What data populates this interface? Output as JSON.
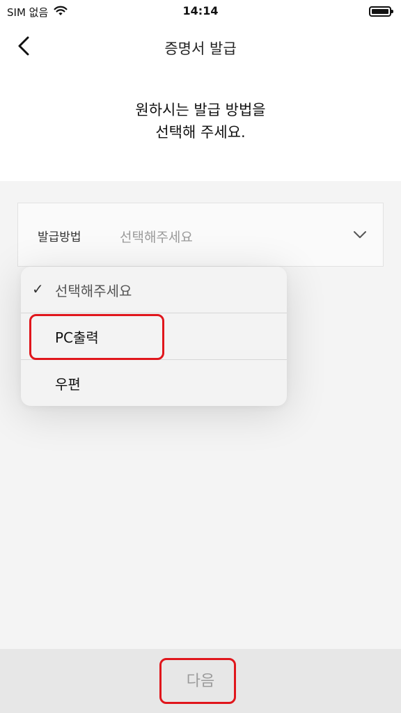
{
  "status_bar": {
    "carrier": "SIM 없음",
    "time": "14:14"
  },
  "header": {
    "title": "증명서 발급"
  },
  "instruction": {
    "line1": "원하시는 발급 방법을",
    "line2": "선택해 주세요."
  },
  "form": {
    "method_label": "발급방법",
    "method_value": "선택해주세요"
  },
  "dropdown": {
    "check_mark": "✓",
    "options": [
      "선택해주세요",
      "PC출력",
      "우편"
    ],
    "selected_index": 0
  },
  "bottom": {
    "next_label": "다음"
  },
  "colors": {
    "highlight": "#e0161c"
  }
}
